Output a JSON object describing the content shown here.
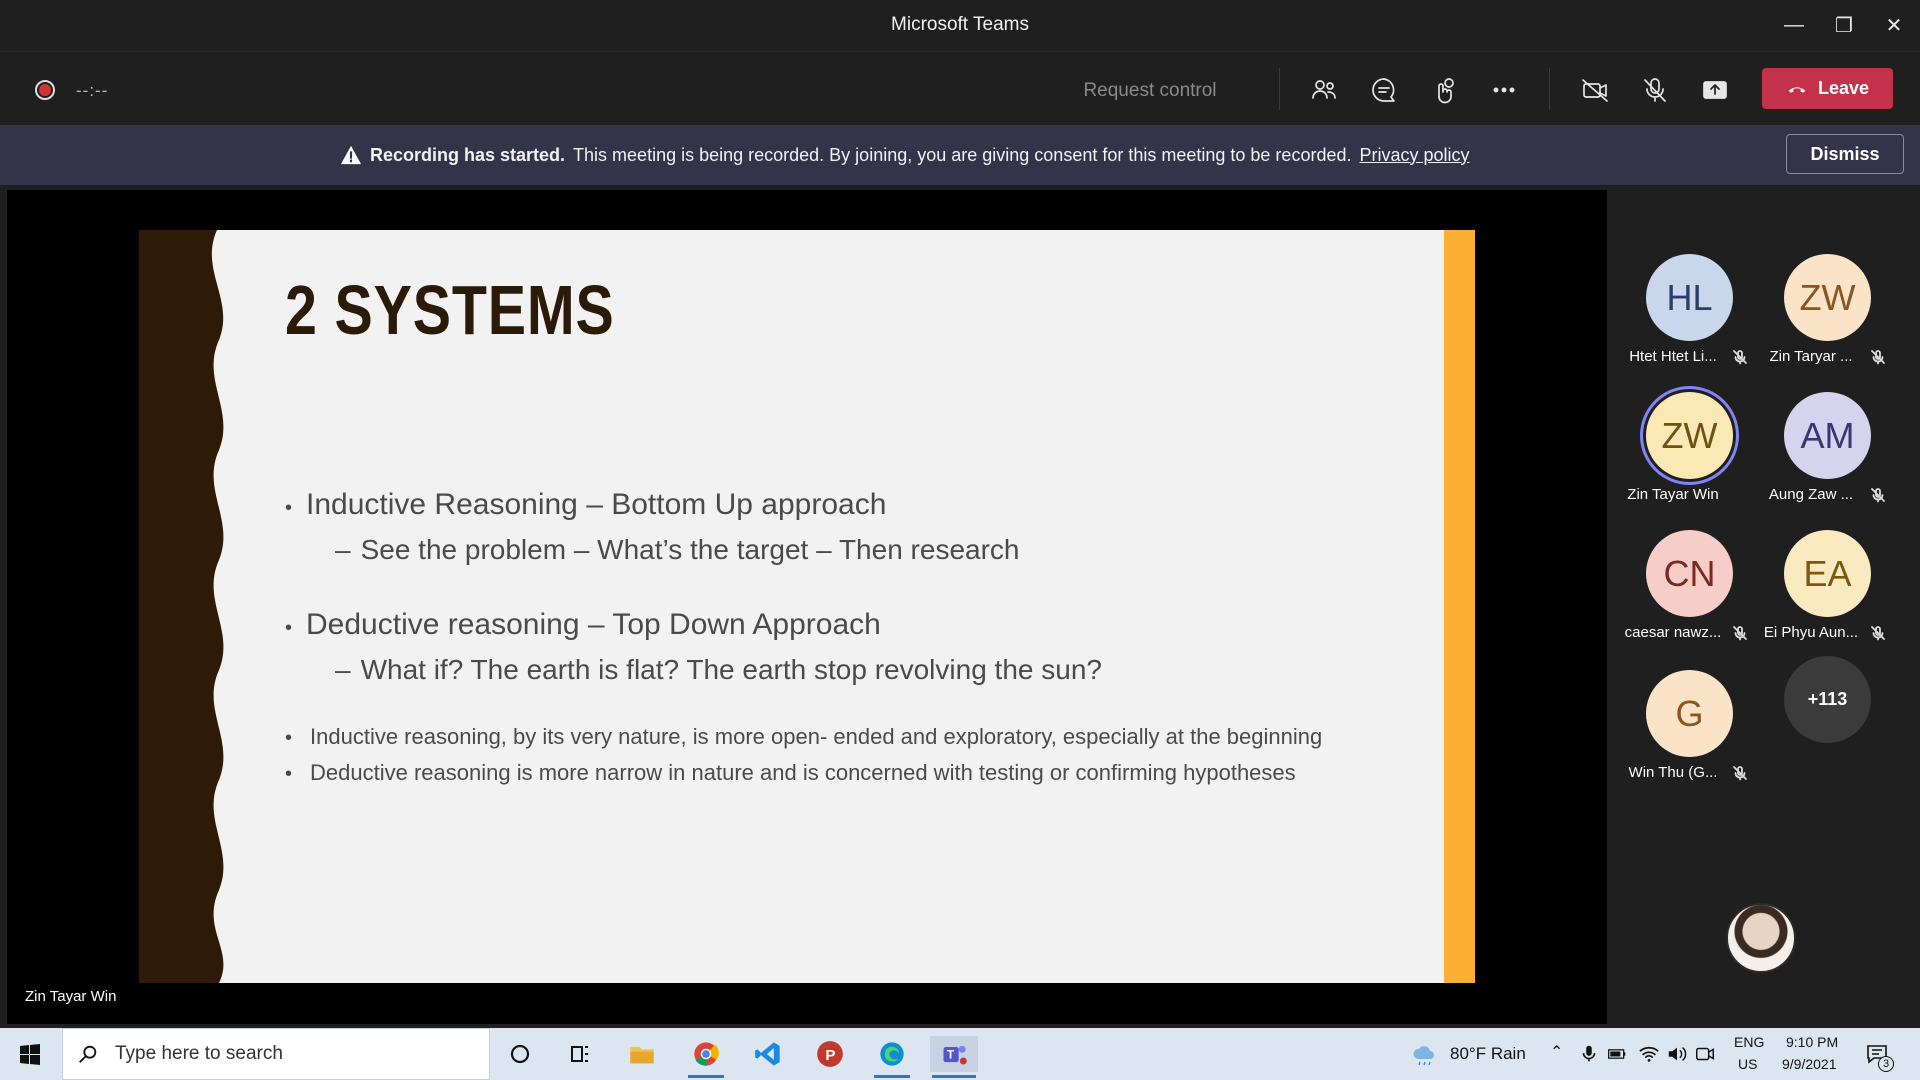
{
  "window": {
    "title": "Microsoft Teams"
  },
  "controls": {
    "timer": "--:--",
    "request_control": "Request control",
    "leave_label": "Leave"
  },
  "banner": {
    "bold": "Recording has started.",
    "text": "This meeting is being recorded. By joining, you are giving consent for this meeting to be recorded.",
    "link": "Privacy policy",
    "dismiss": "Dismiss"
  },
  "slide": {
    "title": "2 SYSTEMS",
    "bullet1": "Inductive Reasoning – Bottom Up approach",
    "bullet1_sub": "See the problem – What’s the target – Then research",
    "bullet2": "Deductive reasoning – Top Down Approach",
    "bullet2_sub": "What if? The earth is flat? The earth stop revolving the sun?",
    "bullet3": "Inductive reasoning, by its very nature, is more open- ended and exploratory, especially at the beginning",
    "bullet4": "Deductive reasoning is more narrow in nature and is concerned with testing or confirming hypotheses",
    "colors": {
      "left_band": "#2e1a07",
      "right_band": "#fbb034",
      "background": "#f2f2f2"
    }
  },
  "presenter_name": "Zin Tayar Win",
  "participants": [
    {
      "initials": "HL",
      "name": "Htet Htet Li...",
      "muted": true,
      "bg": "#c9d7ec",
      "fg": "#2a3f66"
    },
    {
      "initials": "ZW",
      "name": "Zin Taryar ...",
      "muted": true,
      "bg": "#fbe3c8",
      "fg": "#8a5520"
    },
    {
      "initials": "ZW",
      "name": "Zin Tayar Win",
      "muted": false,
      "bg": "#fbe9b5",
      "fg": "#6c5410",
      "speaking": true
    },
    {
      "initials": "AM",
      "name": "Aung Zaw ...",
      "muted": true,
      "bg": "#d6d3ef",
      "fg": "#3a3670"
    },
    {
      "initials": "CN",
      "name": "caesar nawz...",
      "muted": true,
      "bg": "#f7cdc8",
      "fg": "#7a2a22"
    },
    {
      "initials": "EA",
      "name": "Ei Phyu Aun...",
      "muted": true,
      "bg": "#fbe9c0",
      "fg": "#7a5a10"
    },
    {
      "initials": "G",
      "name": "Win Thu (G...",
      "muted": true,
      "bg": "#fbe3c8",
      "fg": "#8a5520"
    },
    {
      "initials": "+113",
      "name": "",
      "muted": false,
      "bg": "#3b3b3b",
      "fg": "#ffffff"
    }
  ],
  "taskbar": {
    "search_placeholder": "Type here to search",
    "weather": "80°F  Rain",
    "lang_top": "ENG",
    "lang_bottom": "US",
    "time": "9:10 PM",
    "date": "9/9/2021",
    "notification_count": "3"
  }
}
